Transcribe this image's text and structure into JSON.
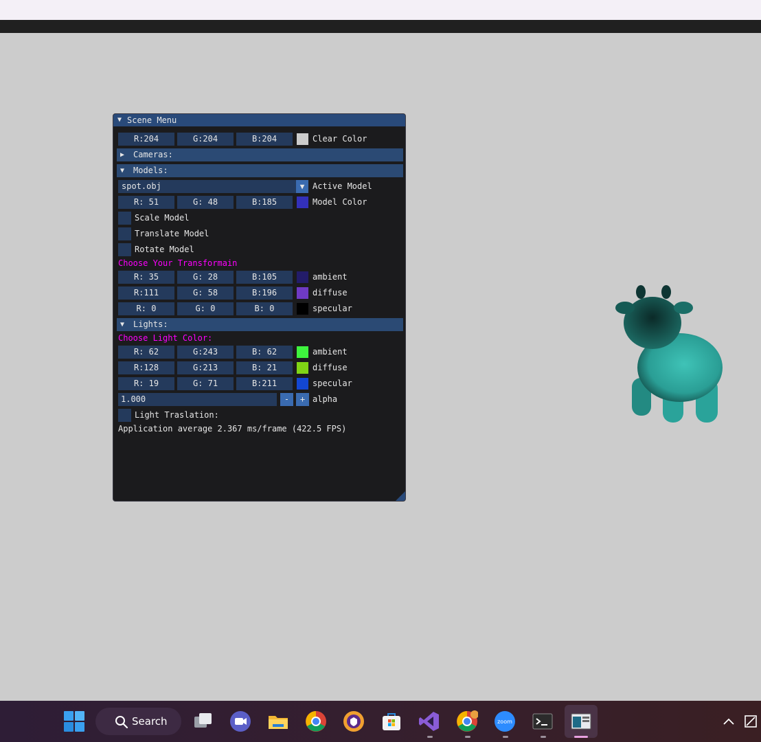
{
  "panel": {
    "title": "Scene Menu",
    "clear_color": {
      "r": "R:204",
      "g": "G:204",
      "b": "B:204",
      "swatch": "#cccccc",
      "label": "Clear Color"
    },
    "cameras_header": "Cameras:",
    "models_header": "Models:",
    "active_model": {
      "value": "spot.obj",
      "label": "Active Model"
    },
    "model_color": {
      "r": "R: 51",
      "g": "G: 48",
      "b": "B:185",
      "swatch": "#3330b9",
      "label": "Model Color"
    },
    "checkboxes": {
      "scale": "Scale Model",
      "translate": "Translate Model",
      "rotate": "Rotate Model"
    },
    "transform_prompt": "Choose Your Transformain",
    "material": [
      {
        "r": "R: 35",
        "g": "G: 28",
        "b": "B:105",
        "swatch": "#231c69",
        "label": "ambient"
      },
      {
        "r": "R:111",
        "g": "G: 58",
        "b": "B:196",
        "swatch": "#6f3ac4",
        "label": "diffuse"
      },
      {
        "r": "R:  0",
        "g": "G:  0",
        "b": "B:  0",
        "swatch": "#000000",
        "label": "specular"
      }
    ],
    "lights_header": "Lights:",
    "light_prompt": "Choose Light Color:",
    "light": [
      {
        "r": "R: 62",
        "g": "G:243",
        "b": "B: 62",
        "swatch": "#3ef33e",
        "label": "ambient"
      },
      {
        "r": "R:128",
        "g": "G:213",
        "b": "B: 21",
        "swatch": "#80d515",
        "label": "diffuse"
      },
      {
        "r": "R: 19",
        "g": "G: 71",
        "b": "B:211",
        "swatch": "#1347d3",
        "label": "specular"
      }
    ],
    "alpha": {
      "value": "1.000",
      "minus": "-",
      "plus": "+",
      "label": "alpha"
    },
    "light_translation": "Light Traslation:",
    "fps_text": "Application average 2.367 ms/frame (422.5 FPS)"
  },
  "taskbar": {
    "search_label": "Search",
    "icons": [
      "windows-start-icon",
      "search-icon",
      "task-view-icon",
      "teams-meet-icon",
      "file-explorer-icon",
      "chrome-icon",
      "bitwarden-icon",
      "microsoft-store-icon",
      "visual-studio-icon",
      "chrome-profile-icon",
      "zoom-icon",
      "terminal-icon",
      "opengl-app-icon",
      "chevron-up-icon",
      "notification-icon"
    ]
  },
  "colors": {
    "clear": "#cccccc",
    "panel_bg": "#1b1b1d",
    "accent": "#294a7a",
    "magenta_text": "#ff00ff",
    "cow": "#2aa39a"
  }
}
